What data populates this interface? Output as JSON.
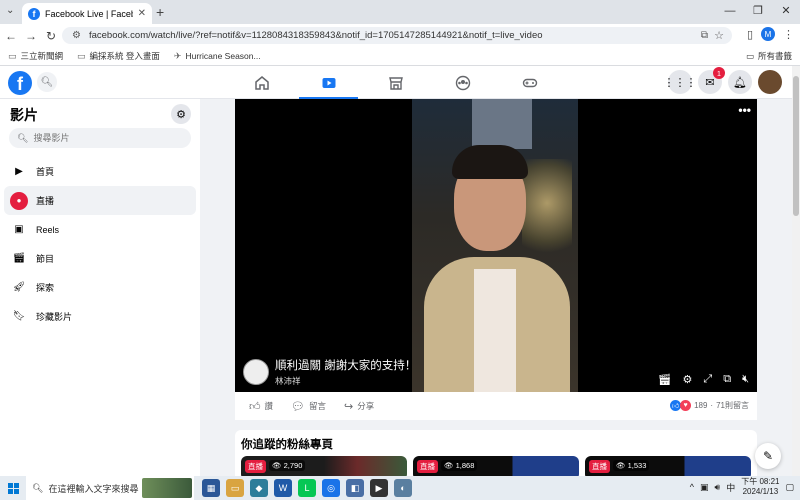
{
  "browser": {
    "tab_title": "Facebook Live | Facebook",
    "url": "facebook.com/watch/live/?ref=notif&v=1128084318359843&notif_id=1705147285144921&notif_t=live_video",
    "profile_initial": "M"
  },
  "bookmarks": {
    "items": [
      "三立新聞網",
      "編採系統 登入畫面",
      "Hurricane Season..."
    ],
    "all_label": "所有書籤"
  },
  "fb": {
    "messenger_badge": "1"
  },
  "sidebar": {
    "title": "影片",
    "search_placeholder": "搜尋影片",
    "items": [
      {
        "label": "首頁",
        "icon": "play-icon"
      },
      {
        "label": "直播",
        "icon": "live-camera-icon"
      },
      {
        "label": "Reels",
        "icon": "reels-icon"
      },
      {
        "label": "節目",
        "icon": "shows-icon"
      },
      {
        "label": "探索",
        "icon": "explore-icon"
      },
      {
        "label": "珍藏影片",
        "icon": "bookmark-icon"
      }
    ]
  },
  "video": {
    "title": "順利過關 謝謝大家的支持！",
    "author": "林沛祥"
  },
  "actions": {
    "like": "讚",
    "comment": "留言",
    "share": "分享",
    "reactions_count": "189",
    "comments_count": "71則留言"
  },
  "followed": {
    "title": "你追蹤的粉絲專頁",
    "cards": [
      {
        "live": "直播",
        "views": "2,790"
      },
      {
        "live": "直播",
        "views": "1,868"
      },
      {
        "live": "直播",
        "views": "1,533"
      }
    ]
  },
  "taskbar": {
    "search_placeholder": "在這裡輸入文字來搜尋",
    "ime": "中",
    "time": "下午 08:21",
    "date": "2024/1/13"
  },
  "colors": {
    "fb_blue": "#1877f2",
    "live_red": "#e41e3f"
  }
}
